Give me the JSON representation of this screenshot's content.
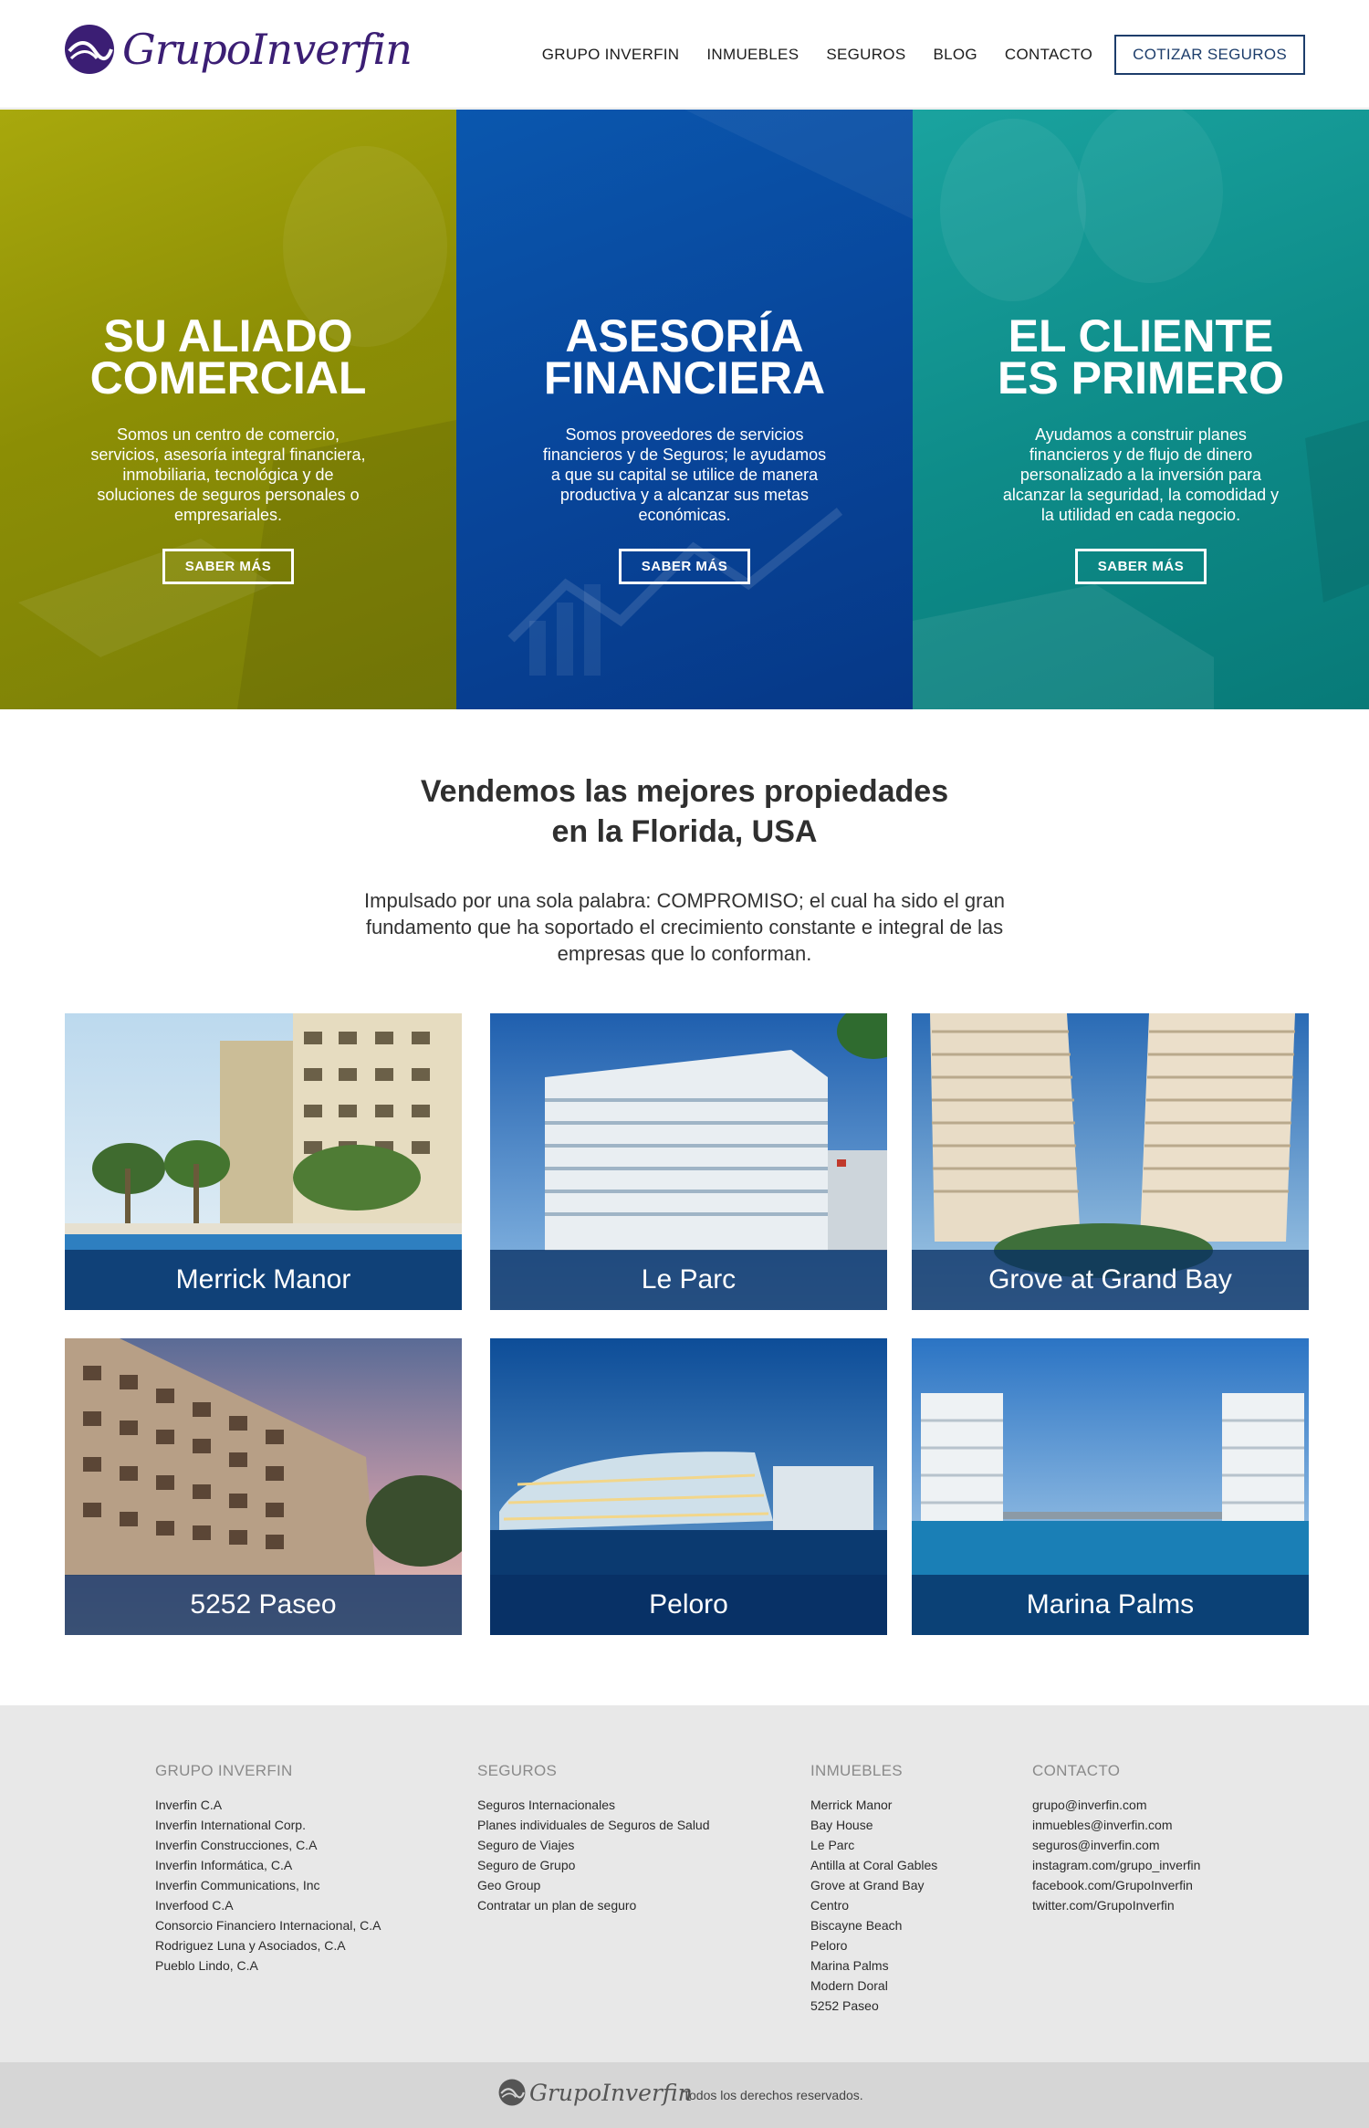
{
  "brand": {
    "name": "GrupoInverfin",
    "accent": "#3b1e74"
  },
  "nav": {
    "items": [
      "GRUPO INVERFIN",
      "INMUEBLES",
      "SEGUROS",
      "BLOG",
      "CONTACTO"
    ],
    "cta": "COTIZAR SEGUROS"
  },
  "hero": {
    "panels": [
      {
        "title_line1": "SU ALIADO",
        "title_line2": "COMERCIAL",
        "text": "Somos un centro de comercio, servicios, asesoría integral financiera, inmobiliaria, tecnológica y de soluciones de seguros personales o empresariales.",
        "button": "SABER MÁS",
        "color": "#9a9b0a"
      },
      {
        "title_line1": "ASESORÍA",
        "title_line2": "FINANCIERA",
        "text": "Somos proveedores de servicios financieros y de Seguros; le ayudamos a que su capital se utilice de manera productiva y a alcanzar sus metas económicas.",
        "button": "SABER MÁS",
        "color": "#0a4fa3"
      },
      {
        "title_line1": "EL CLIENTE",
        "title_line2": "ES PRIMERO",
        "text": "Ayudamos a construir planes financieros y de flujo de dinero personalizado a la inversión para alcanzar la seguridad, la comodidad y la utilidad en cada negocio.",
        "button": "SABER MÁS",
        "color": "#129593"
      }
    ]
  },
  "section": {
    "title_line1": "Vendemos las mejores propiedades",
    "title_line2": "en la Florida, USA",
    "subtitle": "Impulsado por una sola palabra: COMPROMISO; el cual ha sido el gran fundamento que ha soportado el crecimiento constante e integral de las empresas que lo conforman."
  },
  "properties": [
    {
      "name": "Merrick Manor"
    },
    {
      "name": "Le Parc"
    },
    {
      "name": "Grove at Grand Bay"
    },
    {
      "name": "5252 Paseo"
    },
    {
      "name": "Peloro"
    },
    {
      "name": "Marina Palms"
    }
  ],
  "footer": {
    "columns": [
      {
        "heading": "GRUPO INVERFIN",
        "links": [
          "Inverfin C.A",
          "Inverfin International Corp.",
          "Inverfin Construcciones, C.A",
          "Inverfin Informática, C.A",
          "Inverfin Communications, Inc",
          "Inverfood C.A",
          "Consorcio Financiero Internacional, C.A",
          "Rodriguez Luna y Asociados, C.A",
          "Pueblo Lindo, C.A"
        ]
      },
      {
        "heading": "SEGUROS",
        "links": [
          "Seguros Internacionales",
          "Planes individuales de Seguros de Salud",
          "Seguro de Viajes",
          "Seguro de Grupo",
          "Geo Group",
          "Contratar un plan de seguro"
        ]
      },
      {
        "heading": "INMUEBLES",
        "links": [
          "Merrick Manor",
          "Bay House",
          "Le Parc",
          "Antilla at Coral Gables",
          "Grove at Grand Bay",
          "Centro",
          "Biscayne Beach",
          "Peloro",
          "Marina Palms",
          "Modern Doral",
          "5252 Paseo"
        ]
      },
      {
        "heading": "CONTACTO",
        "links": [
          "grupo@inverfin.com",
          "inmuebles@inverfin.com",
          "seguros@inverfin.com",
          "instagram.com/grupo_inverfin",
          "facebook.com/GrupoInverfin",
          "twitter.com/GrupoInverfin"
        ]
      }
    ],
    "bottom_brand": "GrupoInverfin",
    "copyright": "Todos los derechos reservados."
  }
}
